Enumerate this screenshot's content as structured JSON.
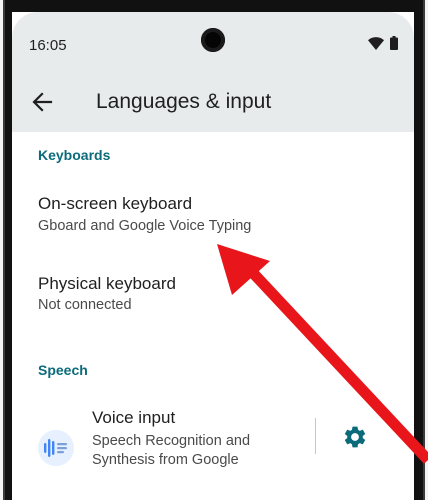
{
  "status_bar": {
    "time": "16:05",
    "wifi_icon": "wifi-icon",
    "battery_icon": "battery-icon"
  },
  "app_bar": {
    "back_icon": "arrow-back-icon",
    "title": "Languages & input",
    "background": "#e8ebec"
  },
  "sections": {
    "keyboards": {
      "header": "Keyboards",
      "items": [
        {
          "title": "On-screen keyboard",
          "subtitle": "Gboard and Google Voice Typing"
        },
        {
          "title": "Physical keyboard",
          "subtitle": "Not connected"
        }
      ]
    },
    "speech": {
      "header": "Speech",
      "voice_input": {
        "title": "Voice input",
        "subtitle_line1": "Speech Recognition and",
        "subtitle_line2": "Synthesis from Google",
        "icon": "google-voice-icon",
        "settings_icon": "gear-icon"
      }
    }
  },
  "colors": {
    "accent": "#0b6b7a",
    "annotation_arrow": "#e8161b"
  }
}
